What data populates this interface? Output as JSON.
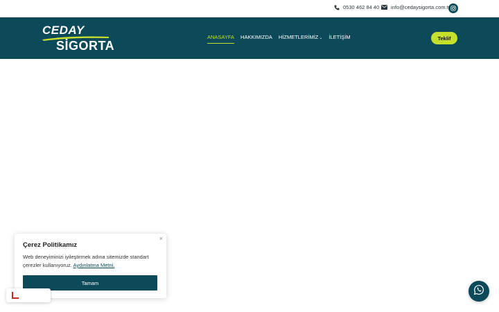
{
  "topbar": {
    "phone": "0530 462 84 40",
    "email": "info@cedaysigorta.com.tr",
    "phone_icon": "phone-icon",
    "email_icon": "envelope-icon",
    "social_icon": "instagram-icon"
  },
  "header": {
    "logo_line1": "CEDAY",
    "logo_line2": "SİGORTA",
    "nav": [
      {
        "label": "ANASAYFA",
        "active": true
      },
      {
        "label": "HAKKIMIZDA",
        "active": false
      },
      {
        "label": "HİZMETLERİMİZ",
        "active": false,
        "has_dropdown": true
      },
      {
        "label": "İLETİŞİM",
        "active": false
      }
    ],
    "cta_label": "Teklif"
  },
  "cookie": {
    "title": "Çerez Politikamız",
    "text": "Web deneyiminizi iyileştirmek adına sitemizde standart çerezler kullanıyoruz.",
    "link_text": "Aydınlatma Metni.",
    "button_label": "Tamam",
    "close_icon": "close-icon"
  },
  "floating": {
    "whatsapp_icon": "whatsapp-icon"
  },
  "colors": {
    "brand_dark": "#0c4a5a",
    "accent": "#c6de2c",
    "background": "#ffffff"
  }
}
